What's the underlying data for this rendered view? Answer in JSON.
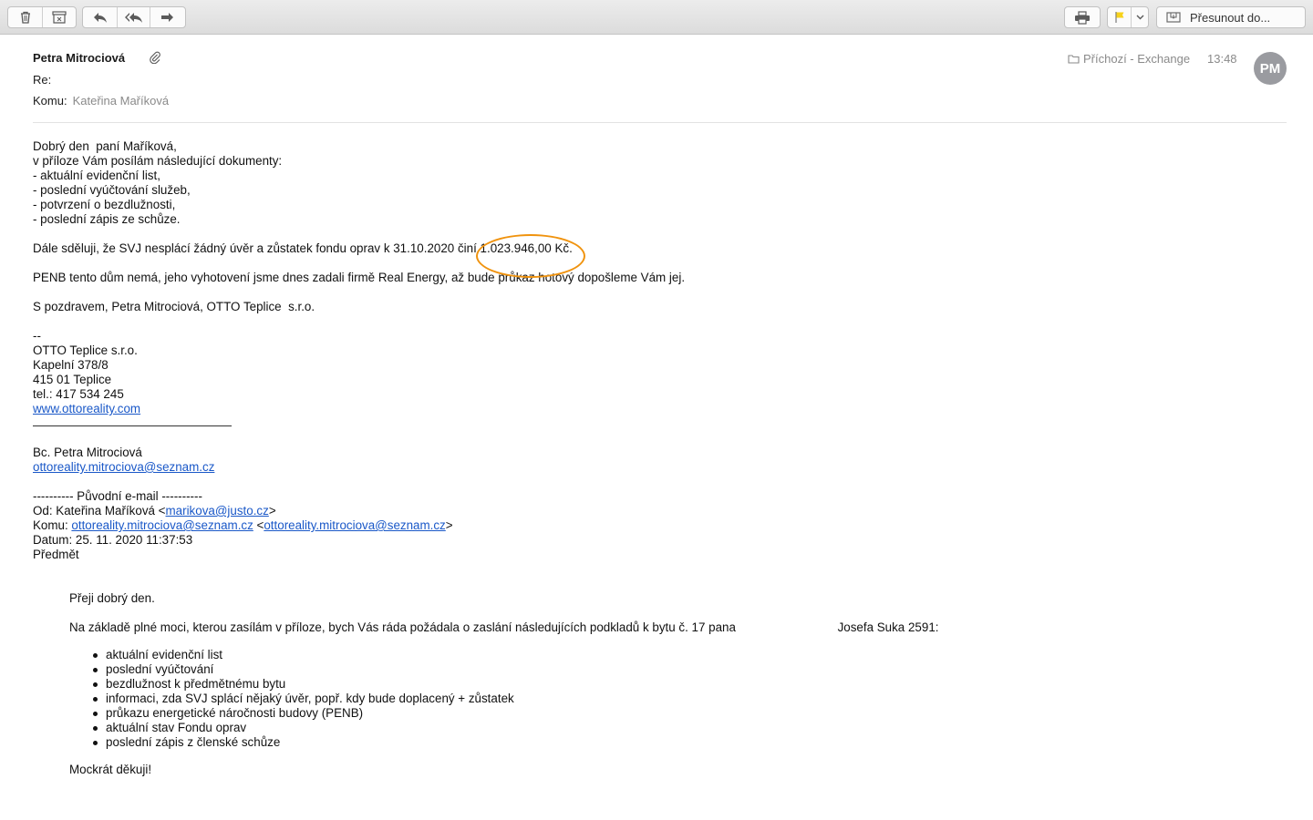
{
  "toolbar": {
    "move_label": "Přesunout do..."
  },
  "header": {
    "sender": "Petra Mitrociová",
    "subject_label": "Re:",
    "to_label": "Komu:",
    "to_name": "Kateřina Maříková",
    "folder": "Příchozí - Exchange",
    "time": "13:48",
    "avatar_initials": "PM"
  },
  "body": {
    "greeting": "Dobrý den  paní Maříková,",
    "intro": "v příloze Vám posílám následující dokumenty:",
    "doc_items": [
      "- aktuální evidenční list,",
      "- poslední vyúčtování služeb,",
      "- potvrzení o bezdlužnosti,",
      "- poslední zápis ze schůze."
    ],
    "fund_text": "Dále sděluji, že SVJ nesplácí žádný úvěr a zůstatek fondu oprav k 31.10.2020 činí ",
    "fund_amount": "1.023.946,00 Kč.",
    "penb_text": "PENB tento dům nemá, jeho vyhotovení jsme dnes zadali firmě Real Energy, až bude průkaz hotový dopošleme Vám jej.",
    "regards": "S pozdravem, Petra Mitrociová, OTTO Teplice  s.r.o.",
    "sig_dash": "--",
    "company": "OTTO Teplice s.r.o.",
    "street": "Kapelní 378/8",
    "city": "415 01 Teplice",
    "phone": "tel.: 417 534 245",
    "website": "www.ottoreality.com",
    "person": "Bc. Petra Mitrociová",
    "person_email": "ottoreality.mitrociova@seznam.cz"
  },
  "original": {
    "separator": "---------- Původní e-mail ----------",
    "from_prefix": "Od: Kateřina Maříková <",
    "from_email": "marikova@justo.cz",
    "from_suffix": ">",
    "to_prefix": "Komu: ",
    "to_email_1": "ottoreality.mitrociova@seznam.cz",
    "to_mid": " <",
    "to_email_2": "ottoreality.mitrociova@seznam.cz",
    "to_suffix": ">",
    "date": "Datum: 25. 11. 2020 11:37:53",
    "subject": "Předmět",
    "q_greeting": "Přeji dobrý den.",
    "q_request": "Na základě plné moci, kterou zasílám v příloze, bych Vás ráda požádala o zaslání následujících podkladů k bytu č. 17 pana                              Josefa Suka 2591:",
    "q_items": [
      "aktuální evidenční list",
      "poslední vyúčtování",
      "bezdlužnost k předmětnému bytu",
      "informaci, zda SVJ splácí nějaký úvěr, popř. kdy bude doplacený + zůstatek",
      "průkazu energetické náročnosti budovy (PENB)",
      "aktuální stav Fondu oprav",
      "poslední zápis z členské schůze"
    ],
    "q_thanks": "Mockrát děkuji!"
  }
}
